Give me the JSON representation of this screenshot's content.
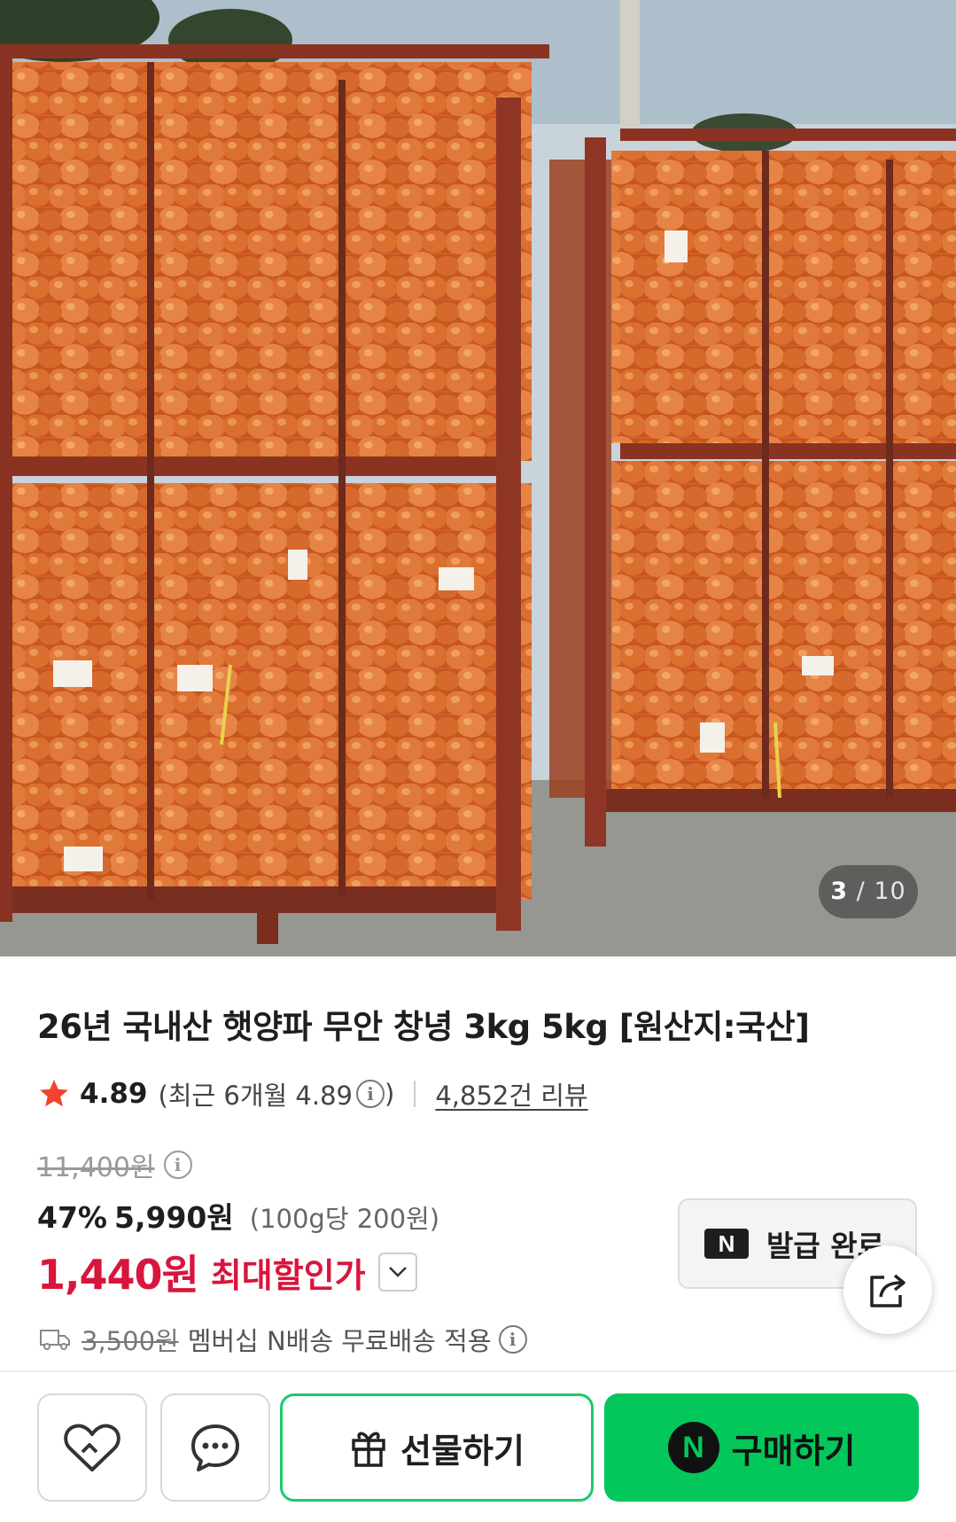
{
  "gallery": {
    "image_alt": "onion-sacks-in-metal-crates-photo",
    "current": "3",
    "separator": "/",
    "total": "10"
  },
  "product": {
    "title": "26년 국내산 햇양파 무안 창녕 3kg 5kg [원산지:국산]"
  },
  "rating": {
    "value": "4.89",
    "recent_label": "(최근 6개월 4.89",
    "recent_close": ")",
    "review_link": "4,852건 리뷰",
    "star_color": "#f0452d"
  },
  "price": {
    "original": "11,400원",
    "discount_rate": "47%",
    "sale_price": "5,990원",
    "unit_price": "(100g당 200원)",
    "max_discount_price": "1,440원",
    "max_discount_label": "최대할인가",
    "accent_color": "#d8153d"
  },
  "coupon": {
    "badge": "N",
    "label": "발급 완료"
  },
  "shipping": {
    "fee": "3,500원",
    "text": "멤버십 N배송 무료배송 적용"
  },
  "actions": {
    "wish_icon": "heart-icon",
    "talk_icon": "chat-bubble-icon",
    "share_icon": "share-icon",
    "gift_label": "선물하기",
    "buy_badge": "N",
    "buy_label": "구매하기",
    "brand_color": "#03c75a"
  }
}
